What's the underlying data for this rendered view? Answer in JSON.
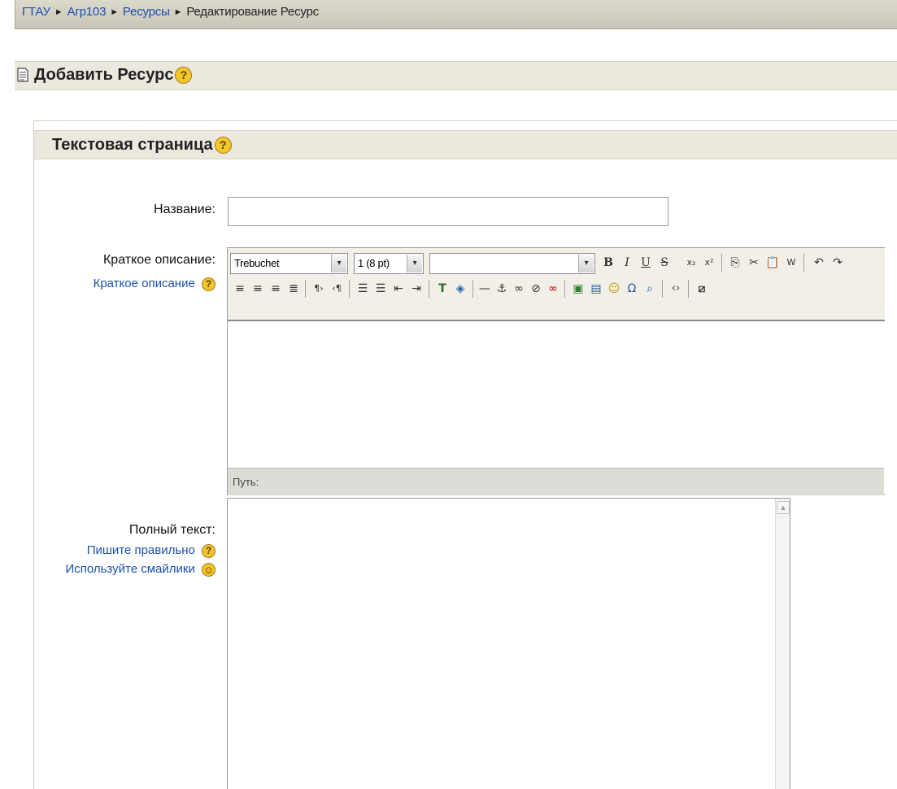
{
  "breadcrumb": {
    "items": [
      "ГТАУ",
      "Агр103",
      "Ресурсы"
    ],
    "separator": "►",
    "current": "Редактирование Ресурс"
  },
  "page": {
    "title": "Добавить Ресурс",
    "help_glyph": "?"
  },
  "fieldset": {
    "legend": "Текстовая страница"
  },
  "form": {
    "name_label": "Название:",
    "name_value": "",
    "summary_label": "Краткое описание:",
    "summary_help_link": "Краткое описание",
    "fulltext_label": "Полный текст:",
    "fulltext_help_link": "Пишите правильно",
    "fulltext_smileys_link": "Используйте смайлики"
  },
  "editor": {
    "font_family": "Trebuchet",
    "font_size": "1 (8 pt)",
    "paragraph_style": "",
    "path_label": "Путь:",
    "content": ""
  },
  "icons": {
    "help": "help-icon",
    "smiley": "smiley-icon",
    "document": "document-icon"
  },
  "colors": {
    "link": "#1b4fae",
    "header_bg": "#ebe8de",
    "help_icon": "#f3c62c"
  }
}
